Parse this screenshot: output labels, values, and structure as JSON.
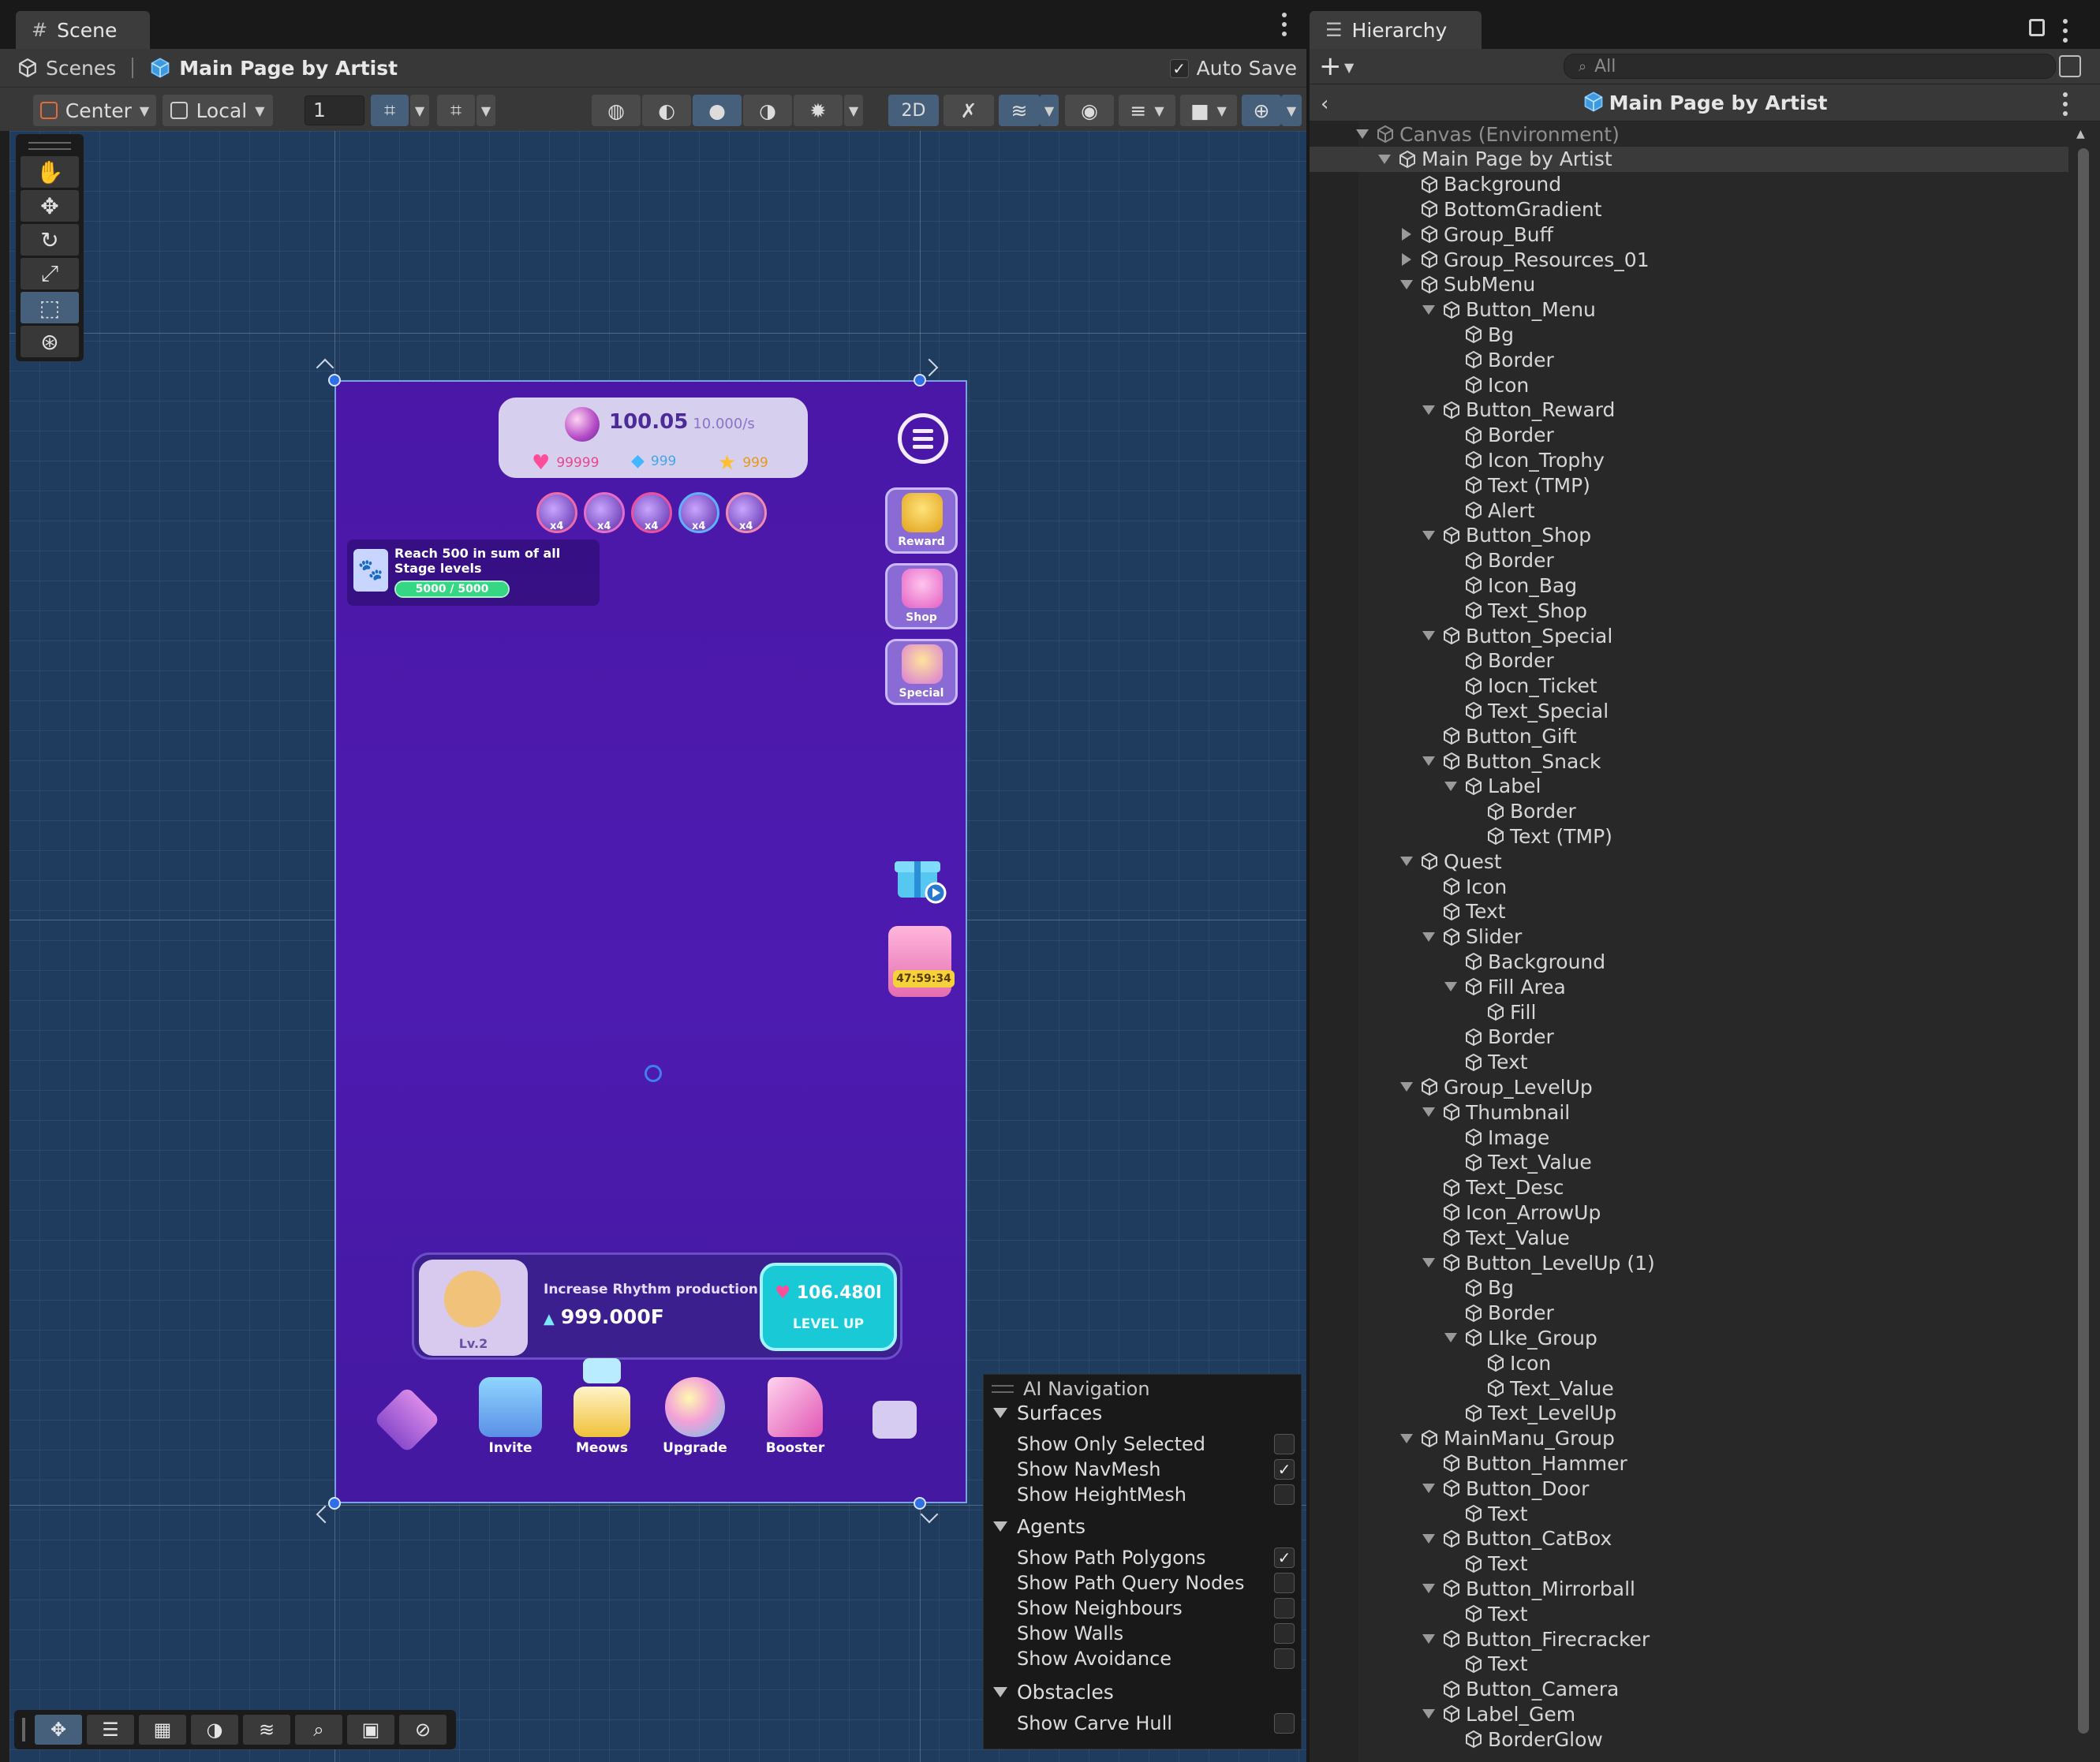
{
  "scene": {
    "tab_label": "Scene",
    "breadcrumb": {
      "root": "Scenes",
      "current": "Main Page by Artist"
    },
    "auto_save": {
      "label": "Auto Save",
      "checked": true
    },
    "toolbar": {
      "pivot_mode": "Center",
      "pivot_rotation": "Local",
      "grid_snap_value": "1",
      "mode_2d": "2D"
    },
    "tools": [
      "hand-icon",
      "move-icon",
      "rotate-icon",
      "scale-icon",
      "rect-tool-icon",
      "transform-icon"
    ]
  },
  "game": {
    "currency": {
      "value": "100.05",
      "rate": "10.000/s"
    },
    "resources": [
      {
        "icon": "heart-icon",
        "value": "99999",
        "color": "#ff5fa8"
      },
      {
        "icon": "gem-icon",
        "value": "999",
        "color": "#5fc8ff"
      },
      {
        "icon": "star-icon",
        "value": "999",
        "color": "#ffb830"
      }
    ],
    "buffs": [
      "x4",
      "x4",
      "x4",
      "x4",
      "x4"
    ],
    "quest": {
      "text": "Reach 500 in sum of all Stage levels",
      "progress": "5000 / 5000",
      "fill": 1.0
    },
    "side_buttons": {
      "reward": "Reward",
      "shop": "Shop",
      "special": "Special",
      "snack_timer": "47:59:34"
    },
    "level_up": {
      "level": "Lv.2",
      "desc": "Increase Rhythm production",
      "value": "999.000F",
      "price": "106.480l",
      "button": "LEVEL UP"
    },
    "bottom_menu": {
      "invite": "Invite",
      "meows": "Meows",
      "upgrade": "Upgrade",
      "booster": "Booster"
    }
  },
  "ai_navigation": {
    "title": "AI Navigation",
    "sections": {
      "surfaces": "Surfaces",
      "agents": "Agents",
      "obstacles": "Obstacles"
    },
    "rows": {
      "show_only_selected": {
        "label": "Show Only Selected",
        "checked": false
      },
      "show_navmesh": {
        "label": "Show NavMesh",
        "checked": true
      },
      "show_heightmesh": {
        "label": "Show HeightMesh",
        "checked": false
      },
      "show_path_polygons": {
        "label": "Show Path Polygons",
        "checked": true
      },
      "show_path_query_nodes": {
        "label": "Show Path Query Nodes",
        "checked": false
      },
      "show_neighbours": {
        "label": "Show Neighbours",
        "checked": false
      },
      "show_walls": {
        "label": "Show Walls",
        "checked": false
      },
      "show_avoidance": {
        "label": "Show Avoidance",
        "checked": false
      },
      "show_carve_hull": {
        "label": "Show Carve Hull",
        "checked": false
      }
    }
  },
  "hierarchy": {
    "tab_label": "Hierarchy",
    "search_placeholder": "All",
    "title": "Main Page by Artist",
    "nodes": [
      {
        "label": "Canvas (Environment)",
        "depth": 0,
        "expand": "open",
        "style": "dim"
      },
      {
        "label": "Main Page by Artist",
        "depth": 1,
        "expand": "open",
        "style": "selected"
      },
      {
        "label": "Background",
        "depth": 2,
        "expand": "none"
      },
      {
        "label": "BottomGradient",
        "depth": 2,
        "expand": "none"
      },
      {
        "label": "Group_Buff",
        "depth": 2,
        "expand": "closed"
      },
      {
        "label": "Group_Resources_01",
        "depth": 2,
        "expand": "closed"
      },
      {
        "label": "SubMenu",
        "depth": 2,
        "expand": "open"
      },
      {
        "label": "Button_Menu",
        "depth": 3,
        "expand": "open"
      },
      {
        "label": "Bg",
        "depth": 4,
        "expand": "none"
      },
      {
        "label": "Border",
        "depth": 4,
        "expand": "none"
      },
      {
        "label": "Icon",
        "depth": 4,
        "expand": "none"
      },
      {
        "label": "Button_Reward",
        "depth": 3,
        "expand": "open"
      },
      {
        "label": "Border",
        "depth": 4,
        "expand": "none"
      },
      {
        "label": "Icon_Trophy",
        "depth": 4,
        "expand": "none"
      },
      {
        "label": "Text (TMP)",
        "depth": 4,
        "expand": "none"
      },
      {
        "label": "Alert",
        "depth": 4,
        "expand": "none"
      },
      {
        "label": "Button_Shop",
        "depth": 3,
        "expand": "open"
      },
      {
        "label": "Border",
        "depth": 4,
        "expand": "none"
      },
      {
        "label": "Icon_Bag",
        "depth": 4,
        "expand": "none"
      },
      {
        "label": "Text_Shop",
        "depth": 4,
        "expand": "none"
      },
      {
        "label": "Button_Special",
        "depth": 3,
        "expand": "open"
      },
      {
        "label": "Border",
        "depth": 4,
        "expand": "none"
      },
      {
        "label": "Iocn_Ticket",
        "depth": 4,
        "expand": "none"
      },
      {
        "label": "Text_Special",
        "depth": 4,
        "expand": "none"
      },
      {
        "label": "Button_Gift",
        "depth": 3,
        "expand": "none"
      },
      {
        "label": "Button_Snack",
        "depth": 3,
        "expand": "open"
      },
      {
        "label": "Label",
        "depth": 4,
        "expand": "open"
      },
      {
        "label": "Border",
        "depth": 5,
        "expand": "none"
      },
      {
        "label": "Text (TMP)",
        "depth": 5,
        "expand": "none"
      },
      {
        "label": "Quest",
        "depth": 2,
        "expand": "open"
      },
      {
        "label": "Icon",
        "depth": 3,
        "expand": "none"
      },
      {
        "label": "Text",
        "depth": 3,
        "expand": "none"
      },
      {
        "label": "Slider",
        "depth": 3,
        "expand": "open"
      },
      {
        "label": "Background",
        "depth": 4,
        "expand": "none"
      },
      {
        "label": "Fill Area",
        "depth": 4,
        "expand": "open"
      },
      {
        "label": "Fill",
        "depth": 5,
        "expand": "none"
      },
      {
        "label": "Border",
        "depth": 4,
        "expand": "none"
      },
      {
        "label": "Text",
        "depth": 4,
        "expand": "none"
      },
      {
        "label": "Group_LevelUp",
        "depth": 2,
        "expand": "open"
      },
      {
        "label": "Thumbnail",
        "depth": 3,
        "expand": "open"
      },
      {
        "label": "Image",
        "depth": 4,
        "expand": "none"
      },
      {
        "label": "Text_Value",
        "depth": 4,
        "expand": "none"
      },
      {
        "label": "Text_Desc",
        "depth": 3,
        "expand": "none"
      },
      {
        "label": "Icon_ArrowUp",
        "depth": 3,
        "expand": "none"
      },
      {
        "label": "Text_Value",
        "depth": 3,
        "expand": "none"
      },
      {
        "label": "Button_LevelUp (1)",
        "depth": 3,
        "expand": "open"
      },
      {
        "label": "Bg",
        "depth": 4,
        "expand": "none"
      },
      {
        "label": "Border",
        "depth": 4,
        "expand": "none"
      },
      {
        "label": "LIke_Group",
        "depth": 4,
        "expand": "open"
      },
      {
        "label": "Icon",
        "depth": 5,
        "expand": "none"
      },
      {
        "label": "Text_Value",
        "depth": 5,
        "expand": "none"
      },
      {
        "label": "Text_LevelUp",
        "depth": 4,
        "expand": "none"
      },
      {
        "label": "MainManu_Group",
        "depth": 2,
        "expand": "open"
      },
      {
        "label": "Button_Hammer",
        "depth": 3,
        "expand": "none"
      },
      {
        "label": "Button_Door",
        "depth": 3,
        "expand": "open"
      },
      {
        "label": "Text",
        "depth": 4,
        "expand": "none"
      },
      {
        "label": "Button_CatBox",
        "depth": 3,
        "expand": "open"
      },
      {
        "label": "Text",
        "depth": 4,
        "expand": "none"
      },
      {
        "label": "Button_Mirrorball",
        "depth": 3,
        "expand": "open"
      },
      {
        "label": "Text",
        "depth": 4,
        "expand": "none"
      },
      {
        "label": "Button_Firecracker",
        "depth": 3,
        "expand": "open"
      },
      {
        "label": "Text",
        "depth": 4,
        "expand": "none"
      },
      {
        "label": "Button_Camera",
        "depth": 3,
        "expand": "none"
      },
      {
        "label": "Label_Gem",
        "depth": 3,
        "expand": "open"
      },
      {
        "label": "BorderGlow",
        "depth": 4,
        "expand": "none"
      }
    ]
  }
}
